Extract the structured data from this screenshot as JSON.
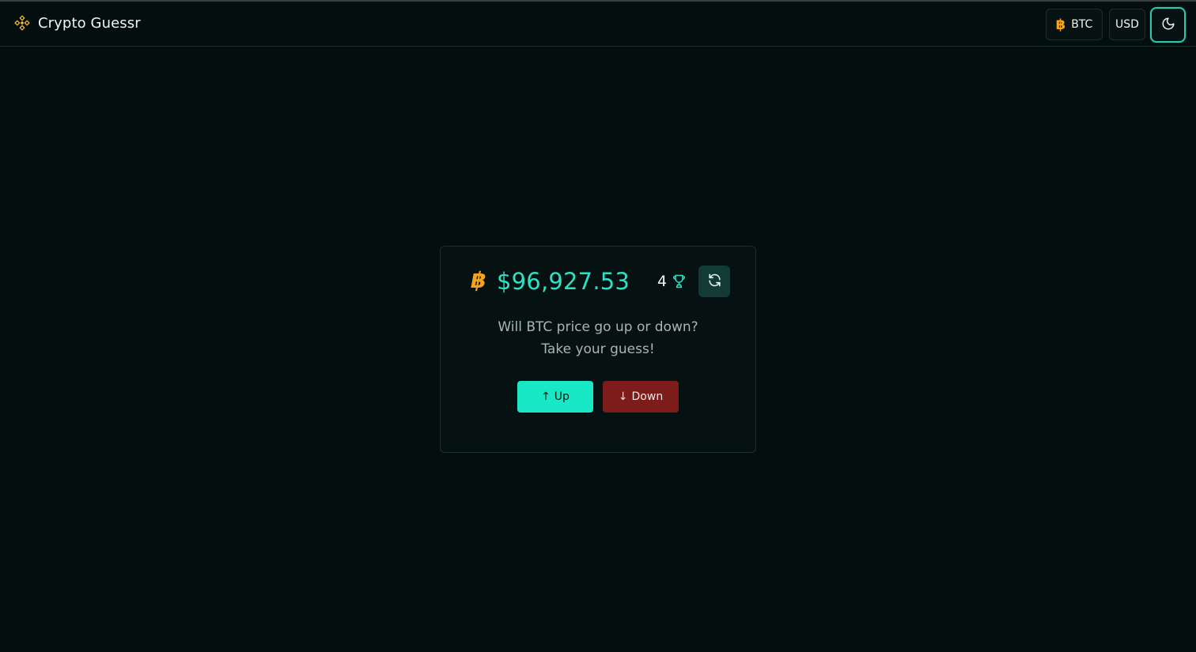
{
  "header": {
    "title": "Crypto Guessr",
    "coin_button": {
      "symbol": "฿",
      "label": "BTC"
    },
    "currency_button": {
      "label": "USD"
    },
    "theme_button": {
      "icon": "moon-icon"
    }
  },
  "game": {
    "coin_symbol": "฿",
    "price": "$96,927.53",
    "score": "4",
    "prompt_line1": "Will BTC price go up or down?",
    "prompt_line2": "Take your guess!",
    "up_button": {
      "arrow": "↑",
      "label": "Up"
    },
    "down_button": {
      "arrow": "↓",
      "label": "Down"
    }
  },
  "colors": {
    "background": "#040e0f",
    "accent": "#2fe0c3",
    "up": "#18e8c6",
    "down": "#7e1b1b",
    "bitcoin": "#f7a21b"
  }
}
